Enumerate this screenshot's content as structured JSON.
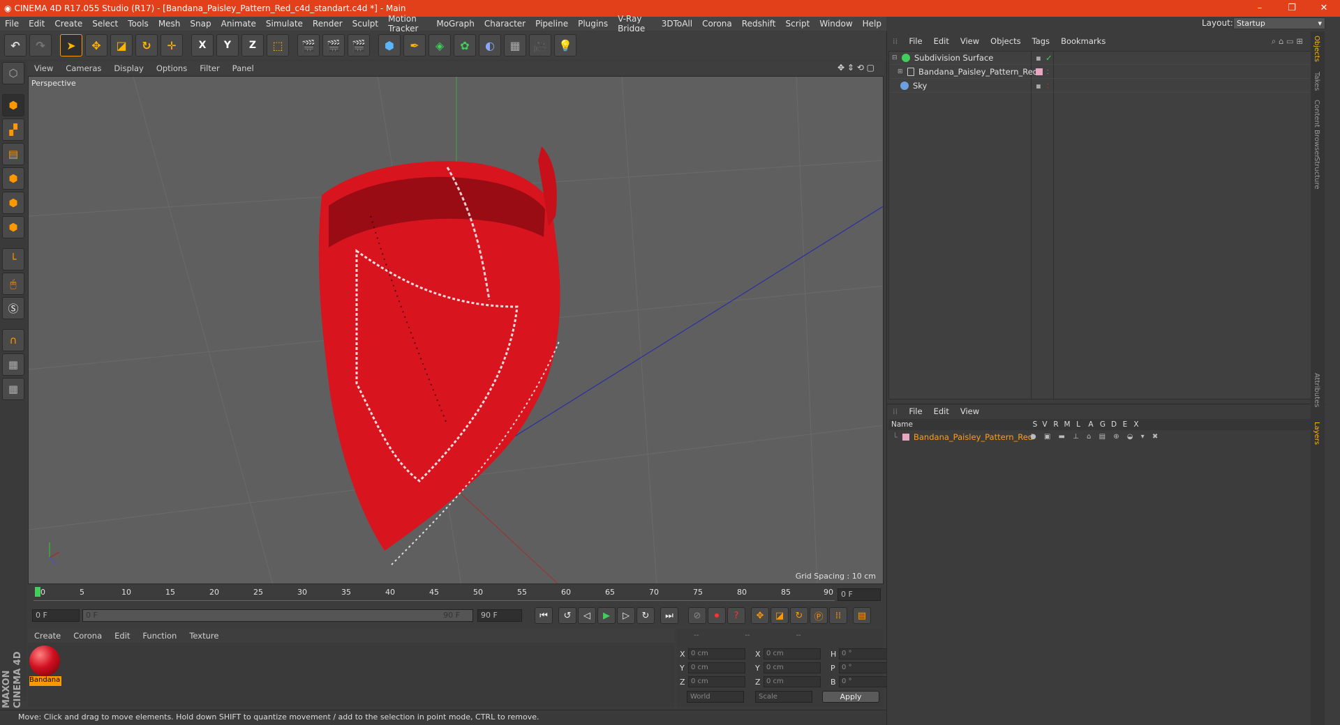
{
  "window": {
    "title": "CINEMA 4D R17.055 Studio (R17) - [Bandana_Paisley_Pattern_Red_c4d_standart.c4d *] - Main",
    "controls": [
      "–",
      "❐",
      "✕"
    ]
  },
  "menu": [
    "File",
    "Edit",
    "Create",
    "Select",
    "Tools",
    "Mesh",
    "Snap",
    "Animate",
    "Simulate",
    "Render",
    "Sculpt",
    "Motion Tracker",
    "MoGraph",
    "Character",
    "Pipeline",
    "Plugins",
    "V-Ray Bridge",
    "3DToAll",
    "Corona",
    "Redshift",
    "Script",
    "Window",
    "Help"
  ],
  "layout": {
    "label": "Layout:",
    "value": "Startup"
  },
  "toolbar": {
    "x": "X",
    "y": "Y",
    "z": "Z"
  },
  "viewport": {
    "menu": [
      "View",
      "Cameras",
      "Display",
      "Options",
      "Filter",
      "Panel"
    ],
    "label": "Perspective",
    "grid_spacing": "Grid Spacing : 10 cm"
  },
  "timeline": {
    "ticks": [
      "0",
      "5",
      "10",
      "15",
      "20",
      "25",
      "30",
      "35",
      "40",
      "45",
      "50",
      "55",
      "60",
      "65",
      "70",
      "75",
      "80",
      "85",
      "90"
    ],
    "current_frame": "0 F",
    "start_field": "0 F",
    "range_start": "0 F",
    "range_end": "90 F",
    "end_field": "90 F"
  },
  "material_manager": {
    "menu": [
      "Create",
      "Corona",
      "Edit",
      "Function",
      "Texture"
    ],
    "material_name": "Bandana"
  },
  "coordinates": {
    "header": [
      "--",
      "--",
      "--"
    ],
    "rows": [
      {
        "a": "X",
        "av": "0 cm",
        "b": "X",
        "bv": "0 cm",
        "c": "H",
        "cv": "0 °"
      },
      {
        "a": "Y",
        "av": "0 cm",
        "b": "Y",
        "bv": "0 cm",
        "c": "P",
        "cv": "0 °"
      },
      {
        "a": "Z",
        "av": "0 cm",
        "b": "Z",
        "bv": "0 cm",
        "c": "B",
        "cv": "0 °"
      }
    ],
    "world": "World",
    "scale": "Scale",
    "apply": "Apply"
  },
  "status": "Move: Click and drag to move elements. Hold down SHIFT to quantize movement / add to the selection in point mode, CTRL to remove.",
  "logo": "MAXON CINEMA 4D",
  "object_manager": {
    "menu": [
      "File",
      "Edit",
      "View",
      "Objects",
      "Tags",
      "Bookmarks"
    ],
    "objects": [
      "Subdivision Surface",
      "Bandana_Paisley_Pattern_Red",
      "Sky"
    ]
  },
  "layer_manager": {
    "menu": [
      "File",
      "Edit",
      "View"
    ],
    "columns": [
      "Name",
      "S",
      "V",
      "R",
      "M",
      "L",
      "A",
      "G",
      "D",
      "E",
      "X"
    ],
    "layer": "Bandana_Paisley_Pattern_Red"
  },
  "side_tabs": [
    "Objects",
    "Takes",
    "Content Browser",
    "Structure",
    "Attributes",
    "Layers"
  ],
  "colors": {
    "title_bar": "#e2401a",
    "accent": "#ff9800",
    "viewport": "#5f5f5f",
    "bandana": "#d8141f"
  }
}
